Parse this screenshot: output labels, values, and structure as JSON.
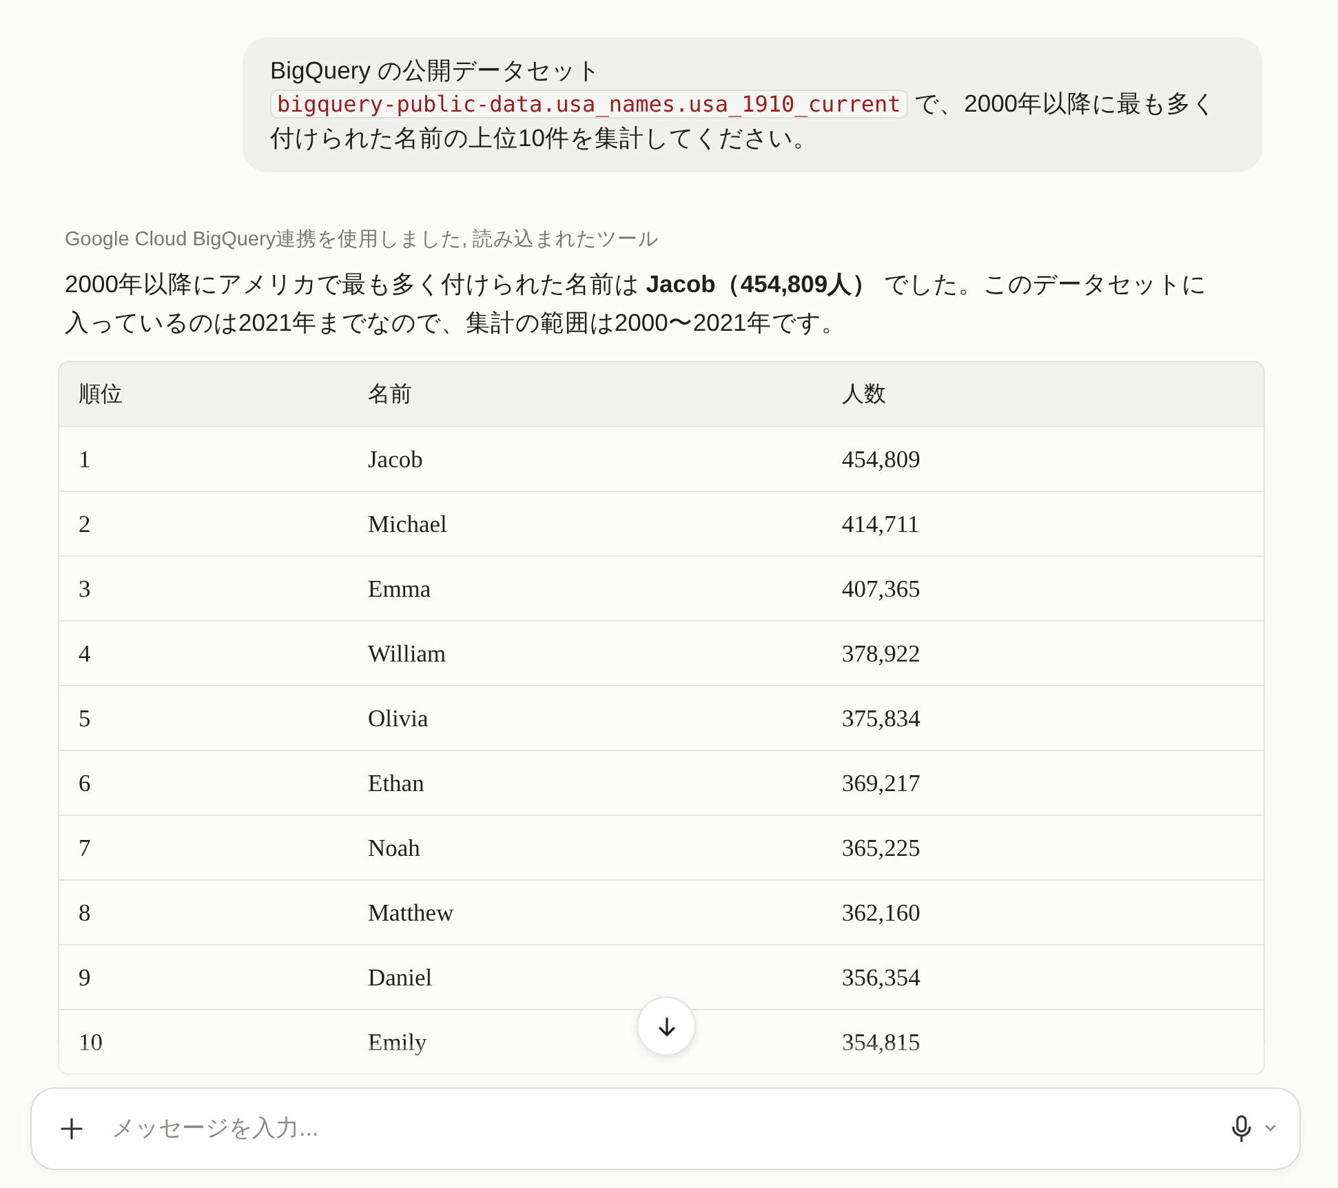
{
  "user_message": {
    "before": "BigQuery の公開データセット ",
    "code": "bigquery-public-data.usa_names.usa_1910_current",
    "after": " で、2000年以降に最も多く付けられた名前の上位10件を集計してください。"
  },
  "tool_note": "Google Cloud BigQuery連携を使用しました, 読み込まれたツール",
  "answer": "2000年以降にアメリカで最も多く付けられた名前は **Jacob（454,809人）** でした。このデータセットに入っているのは2021年までなので、集計の範囲は2000〜2021年です。",
  "table": {
    "columns": [
      "順位",
      "名前",
      "人数"
    ],
    "rows": [
      [
        "1",
        "Jacob",
        "454,809"
      ],
      [
        "2",
        "Michael",
        "414,711"
      ],
      [
        "3",
        "Emma",
        "407,365"
      ],
      [
        "4",
        "William",
        "378,922"
      ],
      [
        "5",
        "Olivia",
        "375,834"
      ],
      [
        "6",
        "Ethan",
        "369,217"
      ],
      [
        "7",
        "Noah",
        "365,225"
      ],
      [
        "8",
        "Matthew",
        "362,160"
      ],
      [
        "9",
        "Daniel",
        "356,354"
      ],
      [
        "10",
        "Emily",
        "354,815"
      ]
    ]
  },
  "composer": {
    "placeholder": "メッセージを入力..."
  }
}
